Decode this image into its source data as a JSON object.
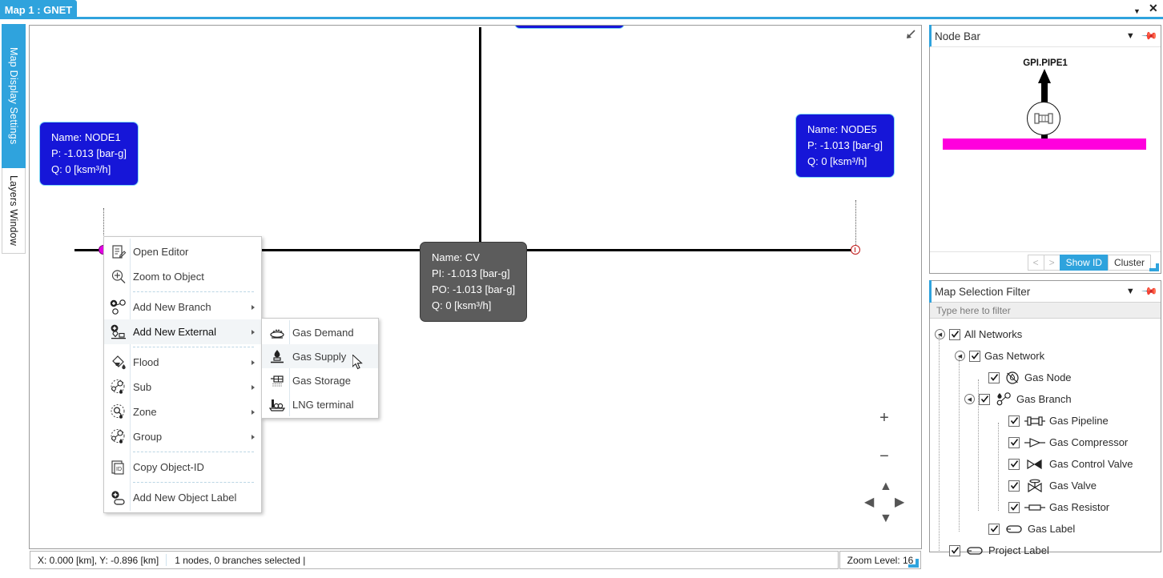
{
  "titlebar": {
    "tab_label": "Map 1 : GNET",
    "caret_icon": "chevron-down-icon",
    "close_icon": "close-icon"
  },
  "vertical_tabs": [
    {
      "label": "Map Display Settings",
      "active": true
    },
    {
      "label": "Layers Window",
      "active": false
    }
  ],
  "map": {
    "collapse_icon": "collapse-arrow-icon",
    "labels": {
      "node1": {
        "name": "Name: NODE1",
        "pressure": "P: -1.013 [bar-g]",
        "flow": "Q: 0 [ksm³/h]"
      },
      "node5": {
        "name": "Name: NODE5",
        "pressure": "P: -1.013 [bar-g]",
        "flow": "Q: 0 [ksm³/h]"
      },
      "cv": {
        "name": "Name: CV",
        "pressure_in": "PI: -1.013 [bar-g]",
        "pressure_out": "PO: -1.013 [bar-g]",
        "flow": "Q: 0 [ksm³/h]"
      }
    },
    "nav": {
      "zoom_in": "+",
      "zoom_out": "−"
    },
    "colors": {
      "node_selected": "#e400e4",
      "node_open": "#c01818",
      "label_blue": "#1616d8",
      "label_gray": "#5c5c5c",
      "control_valve": "#f2ee6a"
    }
  },
  "context_menu": {
    "items": [
      {
        "label": "Open Editor",
        "icon": "open-editor-icon",
        "submenu": false,
        "separator_after": false,
        "highlighted": false
      },
      {
        "label": "Zoom to Object",
        "icon": "zoom-object-icon",
        "submenu": false,
        "separator_after": true,
        "highlighted": false
      },
      {
        "label": "Add New Branch",
        "icon": "add-branch-icon",
        "submenu": true,
        "separator_after": false,
        "highlighted": false
      },
      {
        "label": "Add New External",
        "icon": "add-external-icon",
        "submenu": true,
        "separator_after": true,
        "highlighted": true
      },
      {
        "label": "Flood",
        "icon": "flood-icon",
        "submenu": true,
        "separator_after": false,
        "highlighted": false
      },
      {
        "label": "Sub",
        "icon": "sub-icon",
        "submenu": true,
        "separator_after": false,
        "highlighted": false
      },
      {
        "label": "Zone",
        "icon": "zone-icon",
        "submenu": true,
        "separator_after": false,
        "highlighted": false
      },
      {
        "label": "Group",
        "icon": "group-icon",
        "submenu": true,
        "separator_after": true,
        "highlighted": false
      },
      {
        "label": "Copy Object-ID",
        "icon": "copy-id-icon",
        "submenu": false,
        "separator_after": true,
        "highlighted": false
      },
      {
        "label": "Add New Object Label",
        "icon": "add-label-icon",
        "submenu": false,
        "separator_after": false,
        "highlighted": false
      }
    ],
    "submenu": {
      "items": [
        {
          "label": "Gas Demand",
          "icon": "gas-demand-icon",
          "highlighted": false
        },
        {
          "label": "Gas Supply",
          "icon": "gas-supply-icon",
          "highlighted": true
        },
        {
          "label": "Gas Storage",
          "icon": "gas-storage-icon",
          "highlighted": false
        },
        {
          "label": "LNG terminal",
          "icon": "lng-terminal-icon",
          "highlighted": false
        }
      ]
    }
  },
  "statusbar": {
    "coordinates": "X: 0.000 [km], Y: -0.896 [km]",
    "selection": "1 nodes, 0 branches selected  |",
    "zoom_level": "Zoom Level: 16"
  },
  "node_bar": {
    "title": "Node Bar",
    "caret_icon": "chevron-down-icon",
    "pin_icon": "pin-icon",
    "pipe_label": "GPI.PIPE1",
    "bar_color": "#ff00dd",
    "buttons": {
      "prev": "<",
      "next": ">",
      "show_id": "Show ID",
      "cluster": "Cluster"
    }
  },
  "map_selection_filter": {
    "title": "Map Selection Filter",
    "caret_icon": "chevron-down-icon",
    "pin_icon": "pin-icon",
    "filter_placeholder": "Type here to filter",
    "tree": [
      {
        "label": "All Networks",
        "depth": 0,
        "expander": true,
        "checked": true,
        "icon": null
      },
      {
        "label": "Gas Network",
        "depth": 1,
        "expander": true,
        "checked": true,
        "icon": null
      },
      {
        "label": "Gas Node",
        "depth": 2,
        "expander": false,
        "checked": true,
        "icon": "gas-node-icon"
      },
      {
        "label": "Gas Branch",
        "depth": 2,
        "expander": true,
        "checked": true,
        "icon": "gas-branch-icon"
      },
      {
        "label": "Gas Pipeline",
        "depth": 3,
        "expander": false,
        "checked": true,
        "icon": "gas-pipeline-icon"
      },
      {
        "label": "Gas Compressor",
        "depth": 3,
        "expander": false,
        "checked": true,
        "icon": "gas-compressor-icon"
      },
      {
        "label": "Gas Control Valve",
        "depth": 3,
        "expander": false,
        "checked": true,
        "icon": "gas-control-valve-icon"
      },
      {
        "label": "Gas Valve",
        "depth": 3,
        "expander": false,
        "checked": true,
        "icon": "gas-valve-icon"
      },
      {
        "label": "Gas Resistor",
        "depth": 3,
        "expander": false,
        "checked": true,
        "icon": "gas-resistor-icon"
      },
      {
        "label": "Gas Label",
        "depth": 2,
        "expander": false,
        "checked": true,
        "icon": "gas-label-icon"
      },
      {
        "label": "Project Label",
        "depth": 1,
        "expander": false,
        "checked": true,
        "icon": "project-label-icon"
      }
    ]
  }
}
